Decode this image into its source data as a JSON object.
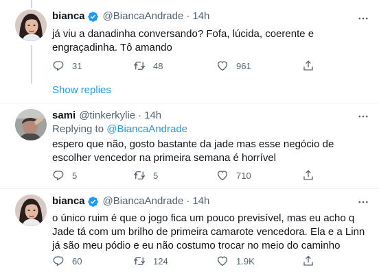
{
  "tweets": [
    {
      "name": "bianca",
      "handle": "@BiancaAndrade",
      "dot": "·",
      "time": "14h",
      "reply_prefix": "",
      "reply_handle": "",
      "text": "já viu a danadinha conversando? Fofa, lúcida, coerente e engraçadinha. Tô amando",
      "replies": "31",
      "retweets": "48",
      "likes": "961"
    },
    {
      "name": "sami",
      "handle": "@tinkerkylie",
      "dot": "·",
      "time": "14h",
      "reply_prefix": "Replying to ",
      "reply_handle": "@BiancaAndrade",
      "text": "espero que não, gosto bastante da jade mas esse negócio de escolher vencedor na primeira semana é horrível",
      "replies": "5",
      "retweets": "5",
      "likes": "710"
    },
    {
      "name": "bianca",
      "handle": "@BiancaAndrade",
      "dot": "·",
      "time": "14h",
      "reply_prefix": "",
      "reply_handle": "",
      "text": "o único ruim é que o jogo fica um pouco previsível, mas eu acho q Jade tá com um brilho de primeira camarote vencedora. Ela e a Linn já são meu pódio e eu não costumo trocar no meio do caminho",
      "replies": "60",
      "retweets": "124",
      "likes": "1.9K"
    }
  ],
  "show_replies": "Show replies",
  "colors": {
    "accent": "#1d9bf0",
    "secondary_text": "#536471",
    "primary_text": "#0f1419",
    "thread_line": "#cfd9de",
    "divider": "#eff3f4"
  },
  "icons": {
    "verified": "verified-badge-icon",
    "more": "more-options-icon",
    "reply": "reply-icon",
    "retweet": "retweet-icon",
    "like": "like-icon",
    "share": "share-icon"
  }
}
